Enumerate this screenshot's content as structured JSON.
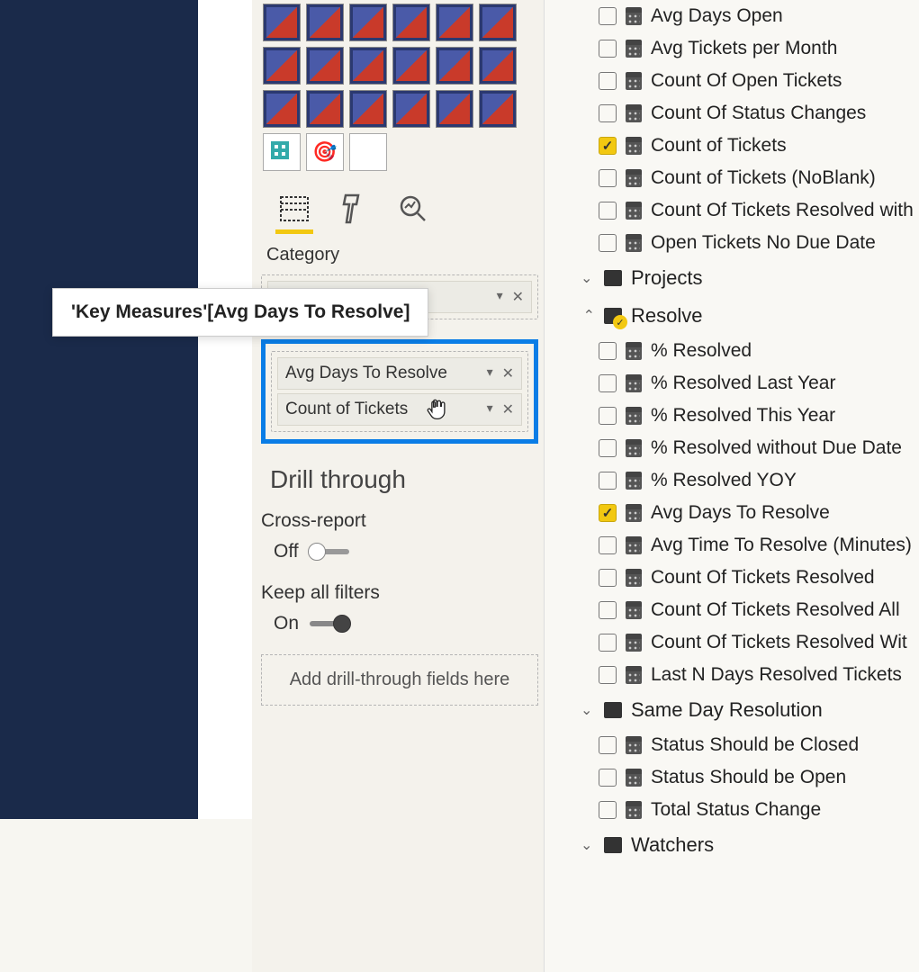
{
  "tooltip_text": "'Key Measures'[Avg Days To Resolve]",
  "viz_pane": {
    "tabs": [
      "fields",
      "format",
      "analytics"
    ],
    "category_label": "Category",
    "category_well_items": [
      ""
    ],
    "values_well_items": [
      "Avg Days To Resolve",
      "Count of Tickets"
    ],
    "drill": {
      "title": "Drill through",
      "cross_report_label": "Cross-report",
      "cross_report_state": "Off",
      "keep_filters_label": "Keep all filters",
      "keep_filters_state": "On",
      "drop_placeholder": "Add drill-through fields here"
    }
  },
  "fields": {
    "key_measures": [
      {
        "label": "Avg Days Open",
        "checked": false
      },
      {
        "label": "Avg Tickets per Month",
        "checked": false
      },
      {
        "label": "Count Of Open Tickets",
        "checked": false
      },
      {
        "label": "Count Of Status Changes",
        "checked": false
      },
      {
        "label": "Count of Tickets",
        "checked": true
      },
      {
        "label": "Count of Tickets (NoBlank)",
        "checked": false
      },
      {
        "label": "Count Of Tickets Resolved with",
        "checked": false
      },
      {
        "label": "Open Tickets No Due Date",
        "checked": false
      }
    ],
    "tables": {
      "projects": "Projects",
      "resolve": "Resolve",
      "same_day": "Same Day Resolution",
      "watchers": "Watchers"
    },
    "resolve_items": [
      {
        "label": "% Resolved",
        "checked": false
      },
      {
        "label": "% Resolved Last Year",
        "checked": false
      },
      {
        "label": "% Resolved This Year",
        "checked": false
      },
      {
        "label": "% Resolved without Due Date",
        "checked": false
      },
      {
        "label": "% Resolved YOY",
        "checked": false
      },
      {
        "label": "Avg Days To Resolve",
        "checked": true
      },
      {
        "label": "Avg Time To Resolve (Minutes)",
        "checked": false
      },
      {
        "label": "Count Of Tickets Resolved",
        "checked": false
      },
      {
        "label": "Count Of Tickets Resolved All",
        "checked": false
      },
      {
        "label": "Count Of Tickets Resolved Wit",
        "checked": false
      },
      {
        "label": "Last N Days Resolved Tickets",
        "checked": false
      }
    ],
    "same_day_items": [
      {
        "label": "Status Should be Closed",
        "checked": false
      },
      {
        "label": "Status Should be Open",
        "checked": false
      },
      {
        "label": "Total Status Change",
        "checked": false
      }
    ]
  }
}
